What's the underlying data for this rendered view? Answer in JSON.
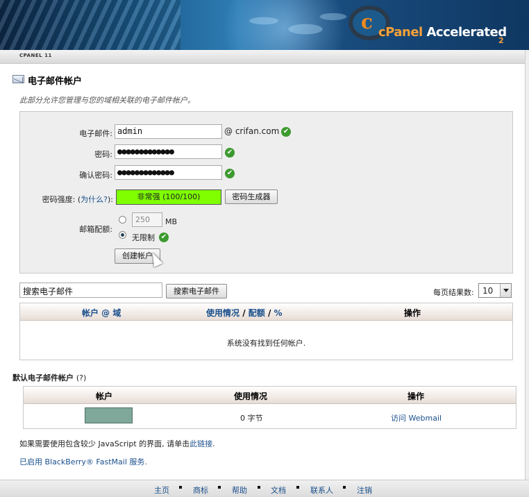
{
  "header": {
    "logo_c": "c",
    "logo_brand": "cPanel",
    "logo_accel": "Accelerated",
    "logo_version": "2",
    "cpanel_version": "CPANEL 11"
  },
  "page": {
    "title": "电子邮件帐户",
    "description": "此部分允许您管理与您的域相关联的电子邮件帐户。"
  },
  "form": {
    "email_label": "电子邮件:",
    "email_value": "admin",
    "domain": "@ crifan.com",
    "password_label": "密码:",
    "password_value": "●●●●●●●●●●●●●",
    "confirm_label": "确认密码:",
    "confirm_value": "●●●●●●●●●●●●●",
    "strength_label": "密码强度: (",
    "strength_why": "为什么?",
    "strength_label_end": "):",
    "strength_text": "非常强 (100/100)",
    "strength_level": 100,
    "generator_button": "密码生成器",
    "quota_label": "邮箱配额:",
    "quota_value": "250",
    "quota_unit": "MB",
    "quota_unlimited": "无限制",
    "create_button": "创建帐户",
    "check_glyph": "✔"
  },
  "search": {
    "value": "搜索电子邮件",
    "button": "搜索电子邮件",
    "per_page_label": "每页结果数:",
    "per_page_value": "10"
  },
  "accounts_table": {
    "col_account": "帐户 @ 域",
    "col_usage": "使用情况",
    "sep1": " / ",
    "col_quota": "配额",
    "sep2": " / ",
    "col_percent": "%",
    "col_actions": "操作",
    "empty": "系统没有找到任何帐户."
  },
  "default_account": {
    "title": "默认电子邮件帐户",
    "help": "(?)",
    "col_account": "帐户",
    "col_usage": "使用情况",
    "col_actions": "操作",
    "usage": "0 字节",
    "action": "访问 Webmail"
  },
  "notes": {
    "lowjs_prefix": "如果需要使用包含较少 JavaScript 的界面, 请单击",
    "lowjs_link": "此链接",
    "lowjs_suffix": ".",
    "bb_prefix": "已启用 ",
    "bb_link": "BlackBerry® FastMail",
    "bb_suffix": " 服务."
  },
  "footer": {
    "home": "主页",
    "trademarks": "商标",
    "help": "帮助",
    "docs": "文档",
    "contact": "联系人",
    "logout": "注销"
  }
}
